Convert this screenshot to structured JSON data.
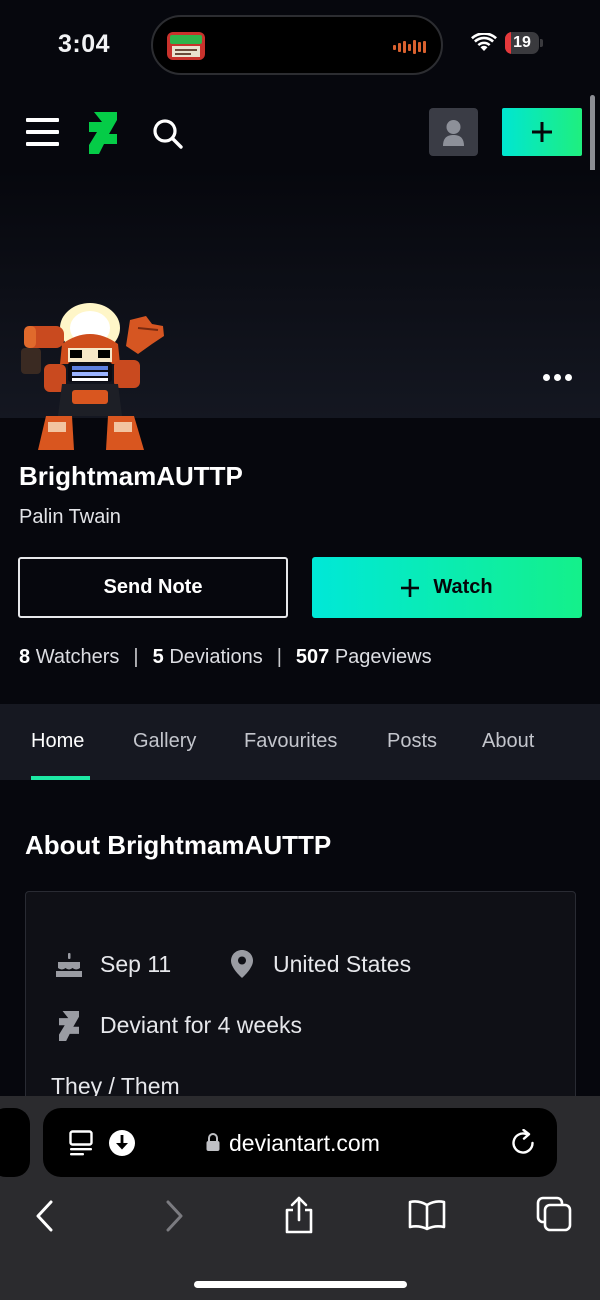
{
  "status_bar": {
    "time": "3:04",
    "battery_level": "19",
    "battery_color": "#e5383b"
  },
  "nav": {
    "menu_icon": "hamburger-icon",
    "logo_icon": "deviantart-logo-icon",
    "search_icon": "search-icon",
    "account_icon": "user-avatar-icon",
    "create_icon": "plus-icon",
    "accent_gradient": [
      "#00e6d2",
      "#1fef7e"
    ]
  },
  "profile": {
    "username": "BrightmamAUTTP",
    "real_name": "Palin Twain",
    "send_note_label": "Send Note",
    "watch_label": "Watch",
    "stats": {
      "watchers_count": "8",
      "watchers_label": "Watchers",
      "deviations_count": "5",
      "deviations_label": "Deviations",
      "pageviews_count": "507",
      "pageviews_label": "Pageviews",
      "separator": "|"
    }
  },
  "tabs": [
    {
      "label": "Home",
      "active": true
    },
    {
      "label": "Gallery",
      "active": false
    },
    {
      "label": "Favourites",
      "active": false
    },
    {
      "label": "Posts",
      "active": false
    },
    {
      "label": "About",
      "active": false
    }
  ],
  "about": {
    "title": "About BrightmamAUTTP",
    "birthday": "Sep 11",
    "location": "United States",
    "member_since": "Deviant for 4 weeks",
    "pronouns": "They / Them"
  },
  "browser": {
    "url": "deviantart.com",
    "toolbar_icons": [
      "back-icon",
      "forward-icon",
      "share-icon",
      "bookmarks-icon",
      "tabs-icon"
    ]
  }
}
